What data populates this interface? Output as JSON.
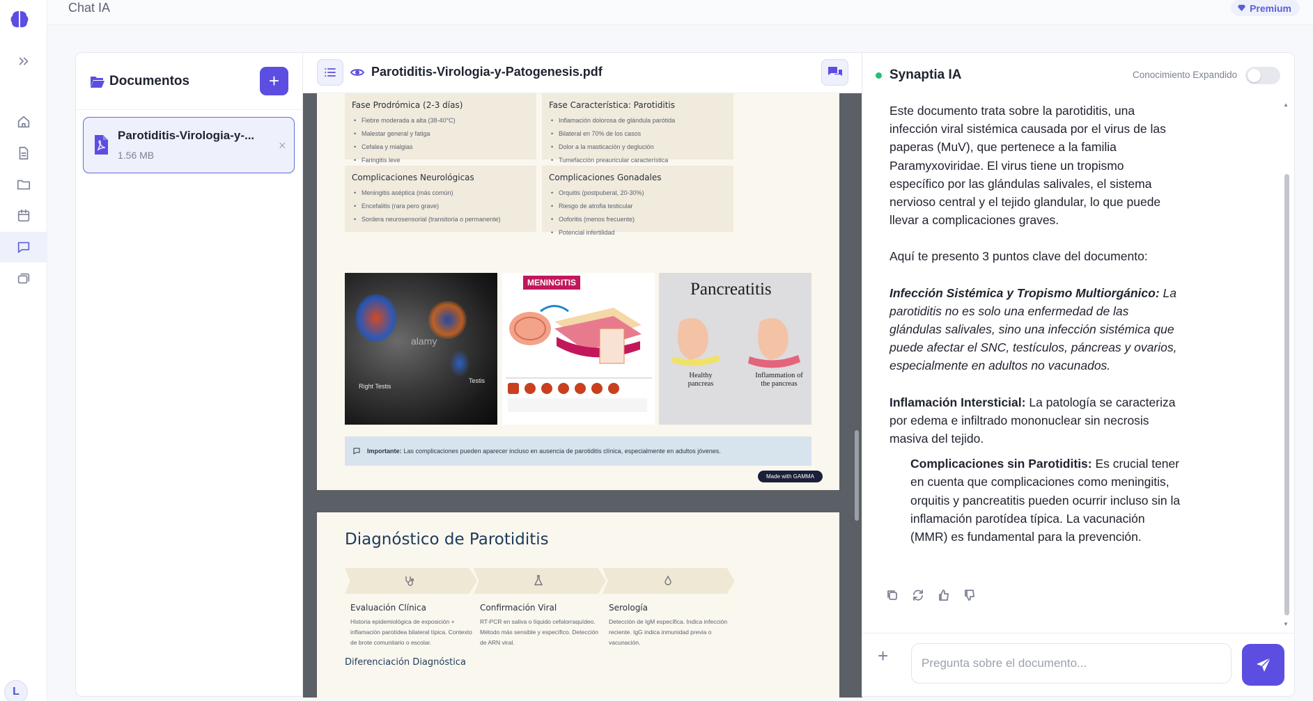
{
  "header": {
    "title": "Chat IA",
    "premium_label": "Premium"
  },
  "sidebar": {
    "avatar_initial": "L",
    "items": [
      {
        "icon": "home-icon"
      },
      {
        "icon": "document-icon"
      },
      {
        "icon": "folder-icon"
      },
      {
        "icon": "calendar-icon"
      },
      {
        "icon": "chat-icon",
        "active": true
      },
      {
        "icon": "cards-icon"
      }
    ]
  },
  "documents": {
    "title": "Documentos",
    "add_label": "+",
    "items": [
      {
        "name": "Parotiditis-Virologia-y-...",
        "size": "1.56 MB",
        "close": "×"
      }
    ]
  },
  "viewer": {
    "file_name": "Parotiditis-Virologia-y-Patogenesis.pdf",
    "page1": {
      "boxes": [
        {
          "title": "Fase Prodrómica (2-3 días)",
          "items": [
            "Fiebre moderada a alta (38-40°C)",
            "Malestar general y fatiga",
            "Cefalea y mialgias",
            "Faringitis leve"
          ]
        },
        {
          "title": "Fase Característica: Parotiditis",
          "items": [
            "Inflamación dolorosa de glándula parótida",
            "Bilateral en 70% de los casos",
            "Dolor a la masticación y deglución",
            "Tumefacción preauricular característica"
          ]
        },
        {
          "title": "Complicaciones Neurológicas",
          "items": [
            "Meningitis aséptica (más común)",
            "Encefalitis (rara pero grave)",
            "Sordera neurosensorial (transitoria o permanente)"
          ]
        },
        {
          "title": "Complicaciones Gonadales",
          "items": [
            "Orquitis (postpuberal, 20-30%)",
            "Riesgo de atrofia testicular",
            "Ooforitis (menos frecuente)",
            "Potencial infertilidad"
          ]
        }
      ],
      "images": {
        "ultrasound_left": "Right Testis",
        "ultrasound_right": "Testis",
        "watermark": "alamy",
        "meningitis_tag": "MENINGITIS",
        "pancreatitis_title": "Pancreatitis",
        "healthy_label": "Healthy pancreas",
        "inflamed_label": "Inflammation of the pancreas"
      },
      "note_label": "Importante:",
      "note_text": "Las complicaciones pueden aparecer incluso en ausencia de parotiditis clínica, especialmente en adultos jóvenes.",
      "badge": "Made with GAMMA"
    },
    "page2": {
      "title": "Diagnóstico de Parotiditis",
      "steps": [
        {
          "title": "Evaluación Clínica",
          "text": "Historia epidemiológica de exposición + inflamación parotídea bilateral típica. Contexto de brote comunitario o escolar.",
          "icon": "stethoscope-icon"
        },
        {
          "title": "Confirmación Viral",
          "text": "RT-PCR en saliva o líquido cefalorraquídeo. Método más sensible y específico. Detección de ARN viral.",
          "icon": "flask-icon"
        },
        {
          "title": "Serología",
          "text": "Detección de IgM específica. Indica infección reciente. IgG indica inmunidad previa o vacunación.",
          "icon": "drop-icon"
        }
      ],
      "subtitle": "Diferenciación Diagnóstica"
    }
  },
  "chat": {
    "title": "Synaptia IA",
    "toggle_label": "Conocimiento Expandido",
    "toggle_on": false,
    "message": {
      "intro": "Este documento trata sobre la parotiditis, una infección viral sistémica causada por el virus de las paperas (MuV), que pertenece a la familia Paramyxoviridae. El virus tiene un tropismo específico por las glándulas salivales, el sistema nervioso central y el tejido glandular, lo que puede llevar a complicaciones graves.",
      "lead": "Aquí te presento 3 puntos clave del documento:",
      "point1_title": "Infección Sistémica y Tropismo Multiorgánico:",
      "point1_text": "La parotiditis no es solo una enfermedad de las glándulas salivales, sino una infección sistémica que puede afectar el SNC, testículos, páncreas y ovarios, especialmente en adultos no vacunados.",
      "point2_title": "Inflamación Intersticial:",
      "point2_text": "La patología se caracteriza por edema e infiltrado mononuclear sin necrosis masiva del tejido.",
      "point3_title": "Complicaciones sin Parotiditis:",
      "point3_text": "Es crucial tener en cuenta que complicaciones como meningitis, orquitis y pancreatitis pueden ocurrir incluso sin la inflamación parotídea típica. La vacunación (MMR) es fundamental para la prevención."
    },
    "actions": [
      "copy-icon",
      "regenerate-icon",
      "thumbs-up-icon",
      "thumbs-down-icon"
    ],
    "input_placeholder": "Pregunta sobre el documento...",
    "input_value": ""
  },
  "colors": {
    "accent": "#5b4ee0",
    "online": "#22c07a",
    "doc_title": "#1d3b5a"
  }
}
